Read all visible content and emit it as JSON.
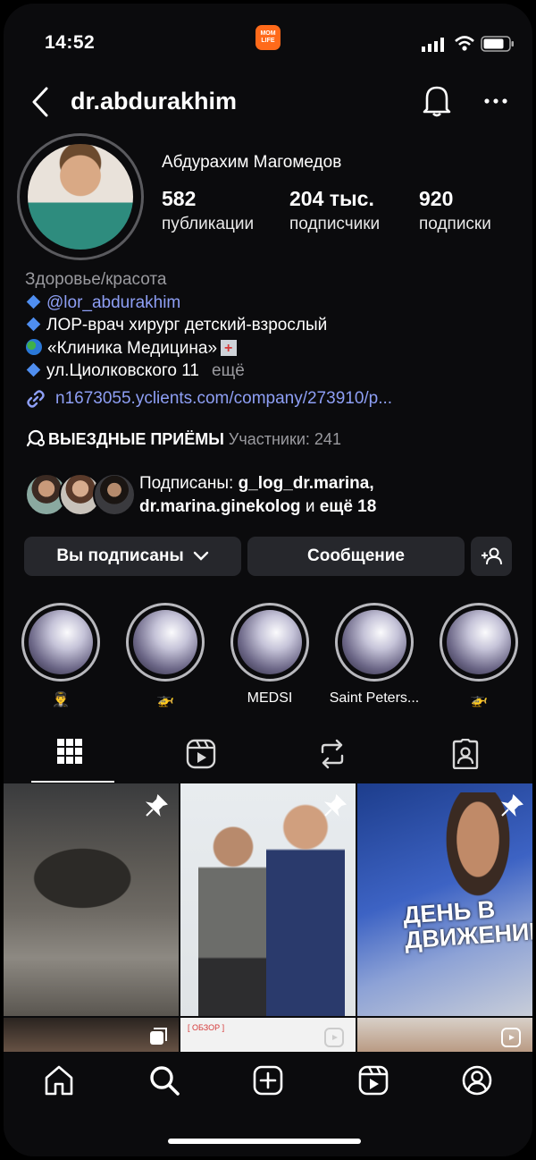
{
  "status": {
    "time": "14:52",
    "app_badge": "MOM LIFE"
  },
  "header": {
    "username": "dr.abdurakhim"
  },
  "profile": {
    "full_name": "Абдурахим Магомедов",
    "stats": [
      {
        "value": "582",
        "label": "публикации"
      },
      {
        "value": "204 тыс.",
        "label": "подписчики"
      },
      {
        "value": "920",
        "label": "подписки"
      }
    ],
    "category": "Здоровье/красота",
    "bio_tag": "@lor_abdurakhim",
    "bio_line2": "ЛОР-врач хирург детский-взрослый",
    "bio_line3": "«Клиника Медицина»",
    "bio_line4": "ул.Циолковского 11",
    "bio_more": "ещё",
    "link": "n1673055.yclients.com/company/273910/p...",
    "channel_title": "ВЫЕЗДНЫЕ ПРИЁМЫ",
    "channel_sub": "Участники: 241",
    "followed_prefix": "Подписаны: ",
    "followed_user1": "g_log_dr.marina,",
    "followed_user2": "dr.marina.ginekolog",
    "followed_mid": " и ",
    "followed_more": "ещё 18"
  },
  "buttons": {
    "following": "Вы подписаны",
    "message": "Сообщение"
  },
  "highlights": [
    {
      "label": "👨‍✈️"
    },
    {
      "label": "🚁"
    },
    {
      "label": "MEDSI"
    },
    {
      "label": "Saint Peters..."
    },
    {
      "label": "🚁"
    }
  ],
  "posts": {
    "overlay_text_1": "ДЕНЬ В",
    "overlay_text_2": "ДВИЖЕНИИ",
    "obzor": "[ ОБЗОР ]"
  },
  "colors": {
    "background": "#0b0b0d",
    "button": "#26272c",
    "link": "#8e9ff5",
    "secondary": "#9a9a9f"
  }
}
